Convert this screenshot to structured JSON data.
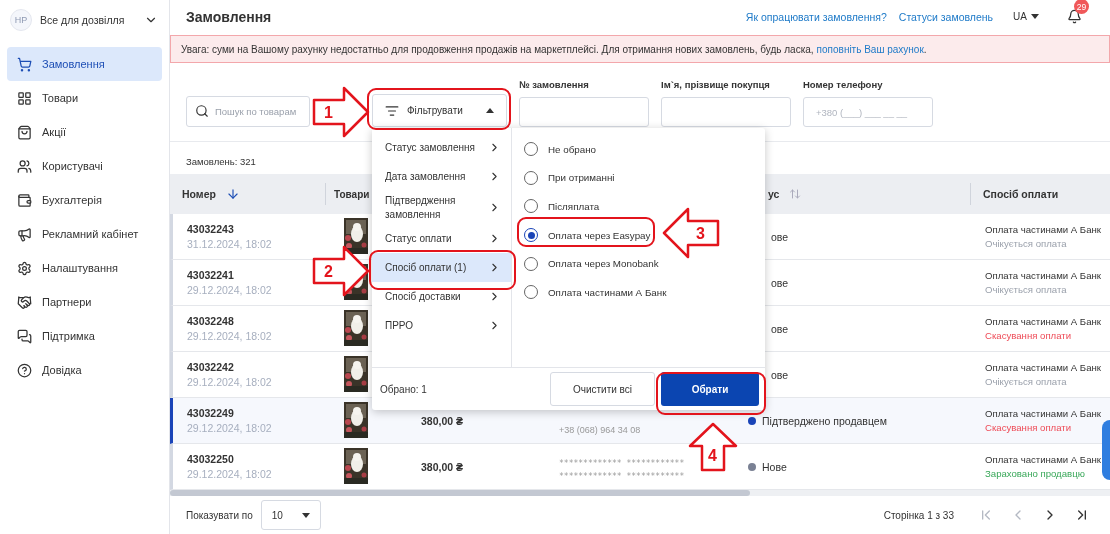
{
  "sidebar": {
    "account": {
      "initials": "НР",
      "name": "Все для дозвілля"
    },
    "items": [
      {
        "label": "Замовлення",
        "selected": true
      },
      {
        "label": "Товари",
        "selected": false
      },
      {
        "label": "Акції",
        "selected": false
      },
      {
        "label": "Користувачі",
        "selected": false
      },
      {
        "label": "Бухгалтерія",
        "selected": false
      },
      {
        "label": "Рекламний кабінет",
        "selected": false
      },
      {
        "label": "Налаштування",
        "selected": false
      },
      {
        "label": "Партнери",
        "selected": false
      },
      {
        "label": "Підтримка",
        "selected": false
      },
      {
        "label": "Довідка",
        "selected": false
      }
    ]
  },
  "header": {
    "title": "Замовлення",
    "links": [
      "Як опрацювати замовлення?",
      "Статуси замовлень"
    ],
    "language": "UA",
    "notifications": "29"
  },
  "alert": {
    "text": "Увага: суми на Вашому рахунку недостатньо для продовження продажів на маркетплейсі. Для отримання нових замовлень, будь ласка, ",
    "link": "поповніть Ваш рахунок",
    "after": "."
  },
  "filters": {
    "search": {
      "placeholder": "Пошук по товарам"
    },
    "filter_button": {
      "label": "Фільтрувати",
      "expanded": true
    },
    "fields": [
      {
        "label": "№ замовлення"
      },
      {
        "label": "Ім`я, прізвище покупця"
      },
      {
        "label": "Номер телефону",
        "placeholder": "+380 (___) ___ __ __"
      }
    ]
  },
  "count": "Замовлень: 321",
  "table": {
    "columns": [
      "Номер",
      "Товари",
      "ус",
      "Спосіб оплати"
    ],
    "rows": [
      {
        "number": "43032243",
        "date": "31.12.2024, 18:02",
        "selected": false,
        "status": "ове",
        "payment": "Оплата частинами А Банк",
        "payment_status": "Очікується оплата",
        "kind": "pending"
      },
      {
        "number": "43032241",
        "date": "29.12.2024, 18:02",
        "selected": false,
        "status": "ове",
        "payment": "Оплата частинами А Банк",
        "payment_status": "Очікується оплата",
        "kind": "pending"
      },
      {
        "number": "43032248",
        "date": "29.12.2024, 18:02",
        "selected": false,
        "status": "ове",
        "payment": "Оплата частинами А Банк",
        "payment_status": "Скасування оплати",
        "kind": "cancelled"
      },
      {
        "number": "43032242",
        "date": "29.12.2024, 18:02",
        "selected": false,
        "status": "ове",
        "payment": "Оплата частинами А Банк",
        "payment_status": "Очікується оплата",
        "kind": "pending"
      },
      {
        "number": "43032249",
        "date": "29.12.2024, 18:02",
        "selected": true,
        "price": "380,00 ₴",
        "customer": [
          "+38 (068) 964 34 08"
        ],
        "status": "Підтверджено продавцем",
        "color": "#1a44b8",
        "payment": "Оплата частинами А Банк",
        "payment_status": "Скасування оплати",
        "kind": "cancelled"
      },
      {
        "number": "43032250",
        "date": "29.12.2024, 18:02",
        "selected": false,
        "price": "380,00 ₴",
        "customer": [
          "************* ************",
          "************* ************"
        ],
        "status": "Нове",
        "color": "#7a8194",
        "payment": "Оплата частинами А Банк",
        "payment_status": "Зараховано продавцю",
        "kind": "credited"
      }
    ]
  },
  "pagination": {
    "label": "Показувати по",
    "page_size": "10",
    "page": "Сторінка 1 з 33",
    "first_disabled": true,
    "prev_disabled": true,
    "next_disabled": false,
    "last_disabled": false
  },
  "filter_popup": {
    "categories": [
      {
        "label": "Статус замовлення",
        "selected": false
      },
      {
        "label": "Дата замовлення",
        "selected": false
      },
      {
        "label": "Підтвердження замовлення",
        "selected": false
      },
      {
        "label": "Статус оплати",
        "selected": false
      },
      {
        "label": "Спосіб оплати (1)",
        "selected": true
      },
      {
        "label": "Спосіб доставки",
        "selected": false
      },
      {
        "label": "ПРРО",
        "selected": false
      }
    ],
    "options": [
      {
        "label": "Не обрано",
        "selected": false
      },
      {
        "label": "При отриманні",
        "selected": false
      },
      {
        "label": "Післяплата",
        "selected": false
      },
      {
        "label": "Оплата через Easypay",
        "selected": true
      },
      {
        "label": "Оплата через Monobank",
        "selected": false
      },
      {
        "label": "Оплата частинами А Банк",
        "selected": false
      }
    ],
    "summary": "Обрано: 1",
    "clear_button": "Очистити всі",
    "apply_button": "Обрати"
  },
  "annotations": [
    {
      "label": "1",
      "kind": "right"
    },
    {
      "label": "2",
      "kind": "right"
    },
    {
      "label": "3",
      "kind": "left"
    },
    {
      "label": "4",
      "kind": "up"
    }
  ]
}
